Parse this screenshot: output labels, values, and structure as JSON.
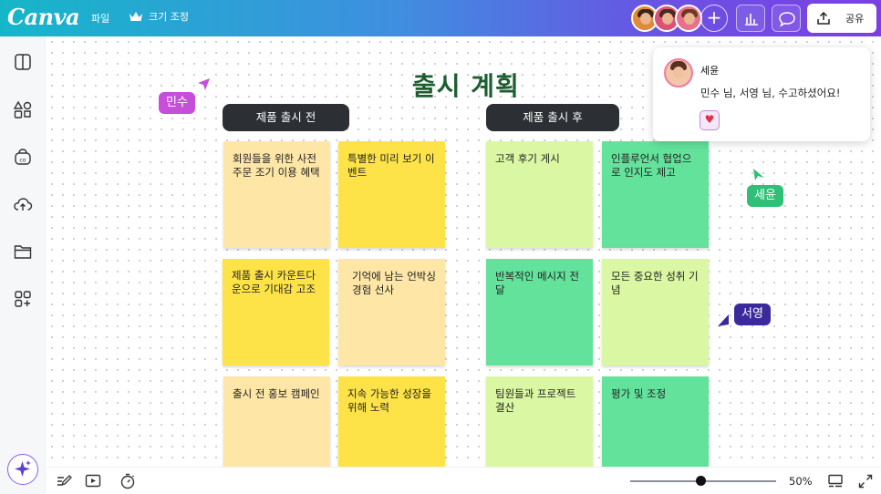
{
  "app": {
    "logo": "Canva"
  },
  "topbar": {
    "file_menu": "파일",
    "resize_menu": "크기 조정",
    "share_label": "공유"
  },
  "board": {
    "title": "출시 계획",
    "sections": [
      {
        "label": "제품 출시 전"
      },
      {
        "label": "제품 출시 후"
      }
    ],
    "notes": [
      {
        "text": "회원들을 위한 사전 주문 조기 이용 혜택",
        "color": "#fde6a6"
      },
      {
        "text": "특별한 미리 보기 이벤트",
        "color": "#fde347"
      },
      {
        "text": "제품 출시 카운트다운으로 기대감 고조",
        "color": "#fde347"
      },
      {
        "text": "기억에 남는 언박싱 경험 선사",
        "color": "#fde6a6"
      },
      {
        "text": "출시 전 홍보 캠페인",
        "color": "#fde6a6"
      },
      {
        "text": "지속 가능한 성장을 위해 노력",
        "color": "#fde347"
      },
      {
        "text": "고객 후기 게시",
        "color": "#daf7a3"
      },
      {
        "text": "인플루언서 협업으로 인지도 제고",
        "color": "#63e29c"
      },
      {
        "text": "반복적인 메시지 전달",
        "color": "#63e29c"
      },
      {
        "text": "모든 중요한 성취 기념",
        "color": "#daf7a3"
      },
      {
        "text": "팀원들과 프로젝트 결산",
        "color": "#daf7a3"
      },
      {
        "text": "평가 및 조정",
        "color": "#63e29c"
      }
    ]
  },
  "collaborators": [
    {
      "name": "민수",
      "color": "#c54fd8"
    },
    {
      "name": "세윤",
      "color": "#2fbf76"
    },
    {
      "name": "서영",
      "color": "#3b2a9c"
    }
  ],
  "comment": {
    "author": "세윤",
    "text": "민수 님, 서영 님, 수고하셨어요!",
    "reaction": "♥"
  },
  "bottombar": {
    "zoom_percent": 50,
    "zoom_label": "50%"
  },
  "colors": {
    "accent_purple": "#7b3fe4",
    "accent_teal": "#16b6c9",
    "title_green": "#1d5e30"
  },
  "icons": [
    "crown-icon",
    "insights-icon",
    "comment-icon",
    "upload-icon",
    "design-icon",
    "elements-icon",
    "brand-icon",
    "cloud-upload-icon",
    "folder-icon",
    "apps-icon",
    "magic-icon",
    "notes-icon",
    "present-icon",
    "timer-icon",
    "grid-view-icon",
    "fullscreen-icon"
  ]
}
